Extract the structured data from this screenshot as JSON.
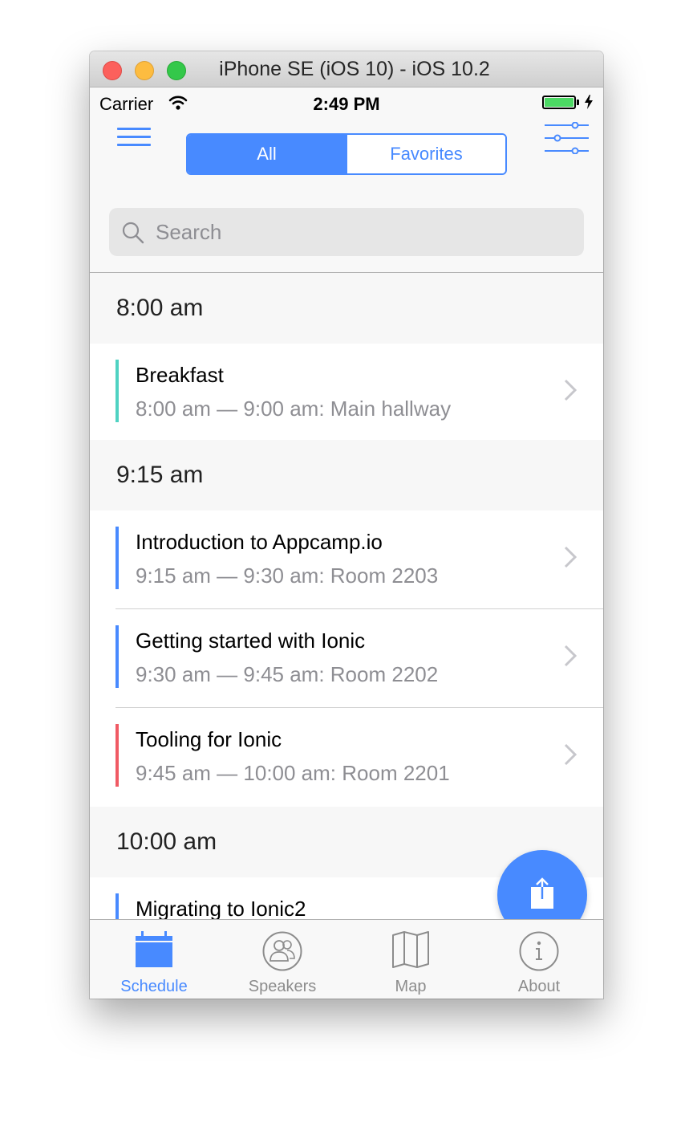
{
  "window": {
    "title": "iPhone SE (iOS 10) - iOS 10.2"
  },
  "status_bar": {
    "carrier": "Carrier",
    "time": "2:49 PM"
  },
  "header": {
    "segments": [
      {
        "label": "All",
        "selected": true
      },
      {
        "label": "Favorites",
        "selected": false
      }
    ]
  },
  "search": {
    "placeholder": "Search",
    "value": ""
  },
  "schedule": [
    {
      "time": "8:00 am",
      "sessions": [
        {
          "title": "Breakfast",
          "subtitle": "8:00 am — 9:00 am: Main hallway",
          "track_color": "#4fd2c2"
        }
      ]
    },
    {
      "time": "9:15 am",
      "sessions": [
        {
          "title": "Introduction to Appcamp.io",
          "subtitle": "9:15 am — 9:30 am: Room 2203",
          "track_color": "#488aff"
        },
        {
          "title": "Getting started with Ionic",
          "subtitle": "9:30 am — 9:45 am: Room 2202",
          "track_color": "#488aff"
        },
        {
          "title": "Tooling for Ionic",
          "subtitle": "9:45 am — 10:00 am: Room 2201",
          "track_color": "#f05a64"
        }
      ]
    },
    {
      "time": "10:00 am",
      "sessions": [
        {
          "title": "Migrating to Ionic2",
          "track_color": "#488aff"
        }
      ]
    }
  ],
  "tabs": [
    {
      "label": "Schedule",
      "icon": "calendar-icon",
      "active": true
    },
    {
      "label": "Speakers",
      "icon": "contacts-icon",
      "active": false
    },
    {
      "label": "Map",
      "icon": "map-icon",
      "active": false
    },
    {
      "label": "About",
      "icon": "information-icon",
      "active": false
    }
  ],
  "colors": {
    "primary": "#488aff",
    "battery": "#4cd964"
  }
}
